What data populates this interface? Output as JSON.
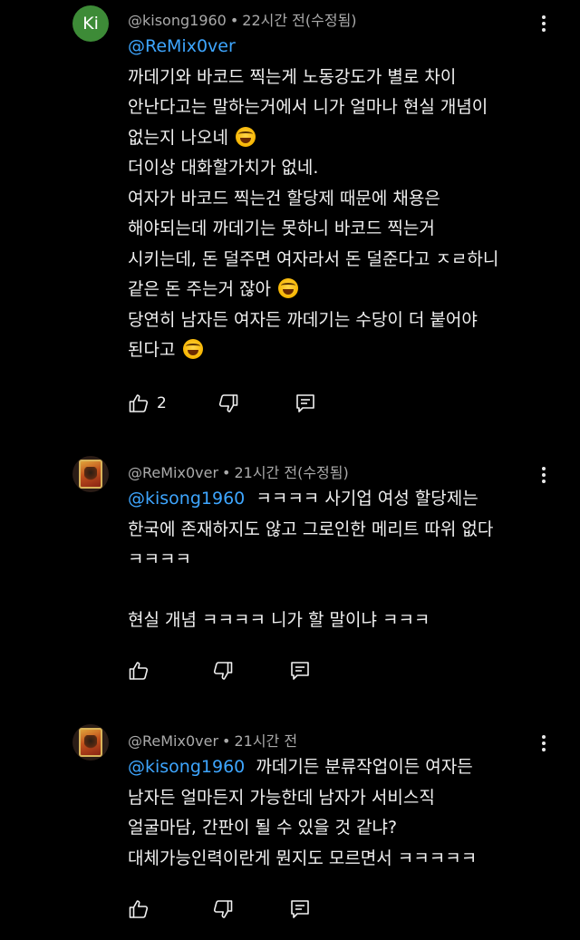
{
  "comments": [
    {
      "avatar_initials": "Ki",
      "author": "@kisong1960",
      "time": "22시간 전(수정됨)",
      "mention": "@ReMix0ver",
      "lines": [
        "까데기와 바코드 찍는게 노동강도가 별로 차이",
        "안난다고는 말하는거에서 니가 얼마나 현실 개념이",
        "없는지 나오네",
        "더이상 대화할가치가 없네.",
        "여자가 바코드 찍는건 할당제 때문에 채용은",
        "해야되는데 까데기는 못하니 바코드 찍는거",
        "시키는데, 돈 덜주면 여자라서 돈 덜준다고 ㅈㄹ하니",
        "같은 돈 주는거 잖아",
        "당연히 남자든 여자든 까데기는 수당이 더 붙어야",
        "된다고"
      ],
      "like_count": "2"
    },
    {
      "author": "@ReMix0ver",
      "time": "21시간 전(수정됨)",
      "mention": "@kisong1960",
      "first_line_rest": "ㅋㅋㅋㅋ 사기업 여성 할당제는",
      "lines": [
        "한국에 존재하지도 않고 그로인한 메리트 따위 없다",
        "ㅋㅋㅋㅋ",
        "",
        "현실 개념 ㅋㅋㅋㅋ 니가 할 말이냐 ㅋㅋㅋ"
      ]
    },
    {
      "author": "@ReMix0ver",
      "time": "21시간 전",
      "mention": "@kisong1960",
      "first_line_rest": "까데기든 분류작업이든 여자든",
      "lines": [
        "남자든 얼마든지 가능한데 남자가 서비스직",
        "얼굴마담, 간판이 될 수 있을 것 같냐?",
        "대체가능인력이란게 뭔지도 모르면서 ㅋㅋㅋㅋㅋ"
      ]
    }
  ],
  "separator": "•",
  "icons": {
    "like": "thumbs-up-icon",
    "dislike": "thumbs-down-icon",
    "reply": "reply-icon",
    "menu": "more-vertical-icon",
    "emoji": "tears-of-joy-emoji"
  }
}
